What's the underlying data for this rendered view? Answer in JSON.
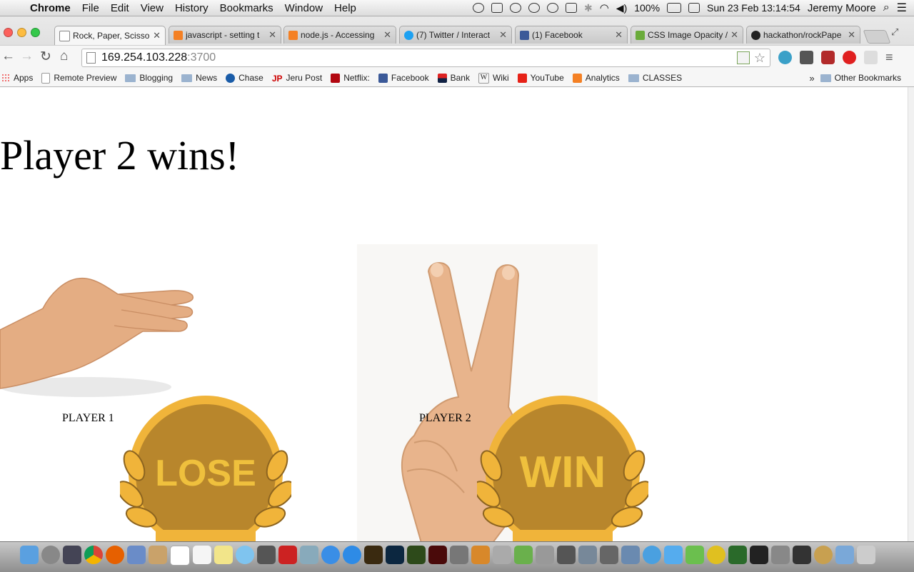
{
  "menubar": {
    "app": "Chrome",
    "items": [
      "File",
      "Edit",
      "View",
      "History",
      "Bookmarks",
      "Window",
      "Help"
    ],
    "battery": "100%",
    "datetime": "Sun 23 Feb  13:14:54",
    "user": "Jeremy Moore"
  },
  "tabs": [
    {
      "title": "Rock, Paper, Scissors",
      "color": "#888888"
    },
    {
      "title": "javascript - setting t",
      "color": "#f48024"
    },
    {
      "title": "node.js - Accessing",
      "color": "#f48024"
    },
    {
      "title": "(7) Twitter / Interact",
      "color": "#1da1f2"
    },
    {
      "title": "(1) Facebook",
      "color": "#3b5998"
    },
    {
      "title": "CSS Image Opacity /",
      "color": "#6aab3a"
    },
    {
      "title": "hackathon/rockPape",
      "color": "#222222"
    }
  ],
  "address": {
    "host": "169.254.103.228",
    "port": ":3700"
  },
  "bookmarks": [
    {
      "label": "Apps",
      "kind": "apps"
    },
    {
      "label": "Remote Preview",
      "kind": "page"
    },
    {
      "label": "Blogging",
      "kind": "folder"
    },
    {
      "label": "News",
      "kind": "folder"
    },
    {
      "label": "Chase",
      "kind": "chase"
    },
    {
      "label": "Jeru Post",
      "kind": "jp"
    },
    {
      "label": "Netflix:",
      "kind": "netflix"
    },
    {
      "label": "Facebook",
      "kind": "facebook"
    },
    {
      "label": "Bank",
      "kind": "bank"
    },
    {
      "label": "Wiki",
      "kind": "wiki"
    },
    {
      "label": "YouTube",
      "kind": "youtube"
    },
    {
      "label": "Analytics",
      "kind": "analytics"
    },
    {
      "label": "CLASSES",
      "kind": "folder"
    }
  ],
  "bookmarks_more": "»",
  "bookmarks_other": "Other Bookmarks",
  "game": {
    "result": "Player 2 wins!",
    "player1": {
      "label": "PLAYER 1",
      "choice": "paper",
      "badge": "LOSE"
    },
    "player2": {
      "label": "PLAYER 2",
      "choice": "scissors",
      "badge": "WIN"
    }
  },
  "colors": {
    "badge_gold": "#b8862c",
    "badge_text": "#efc03d",
    "skin": "#e8b48c"
  }
}
